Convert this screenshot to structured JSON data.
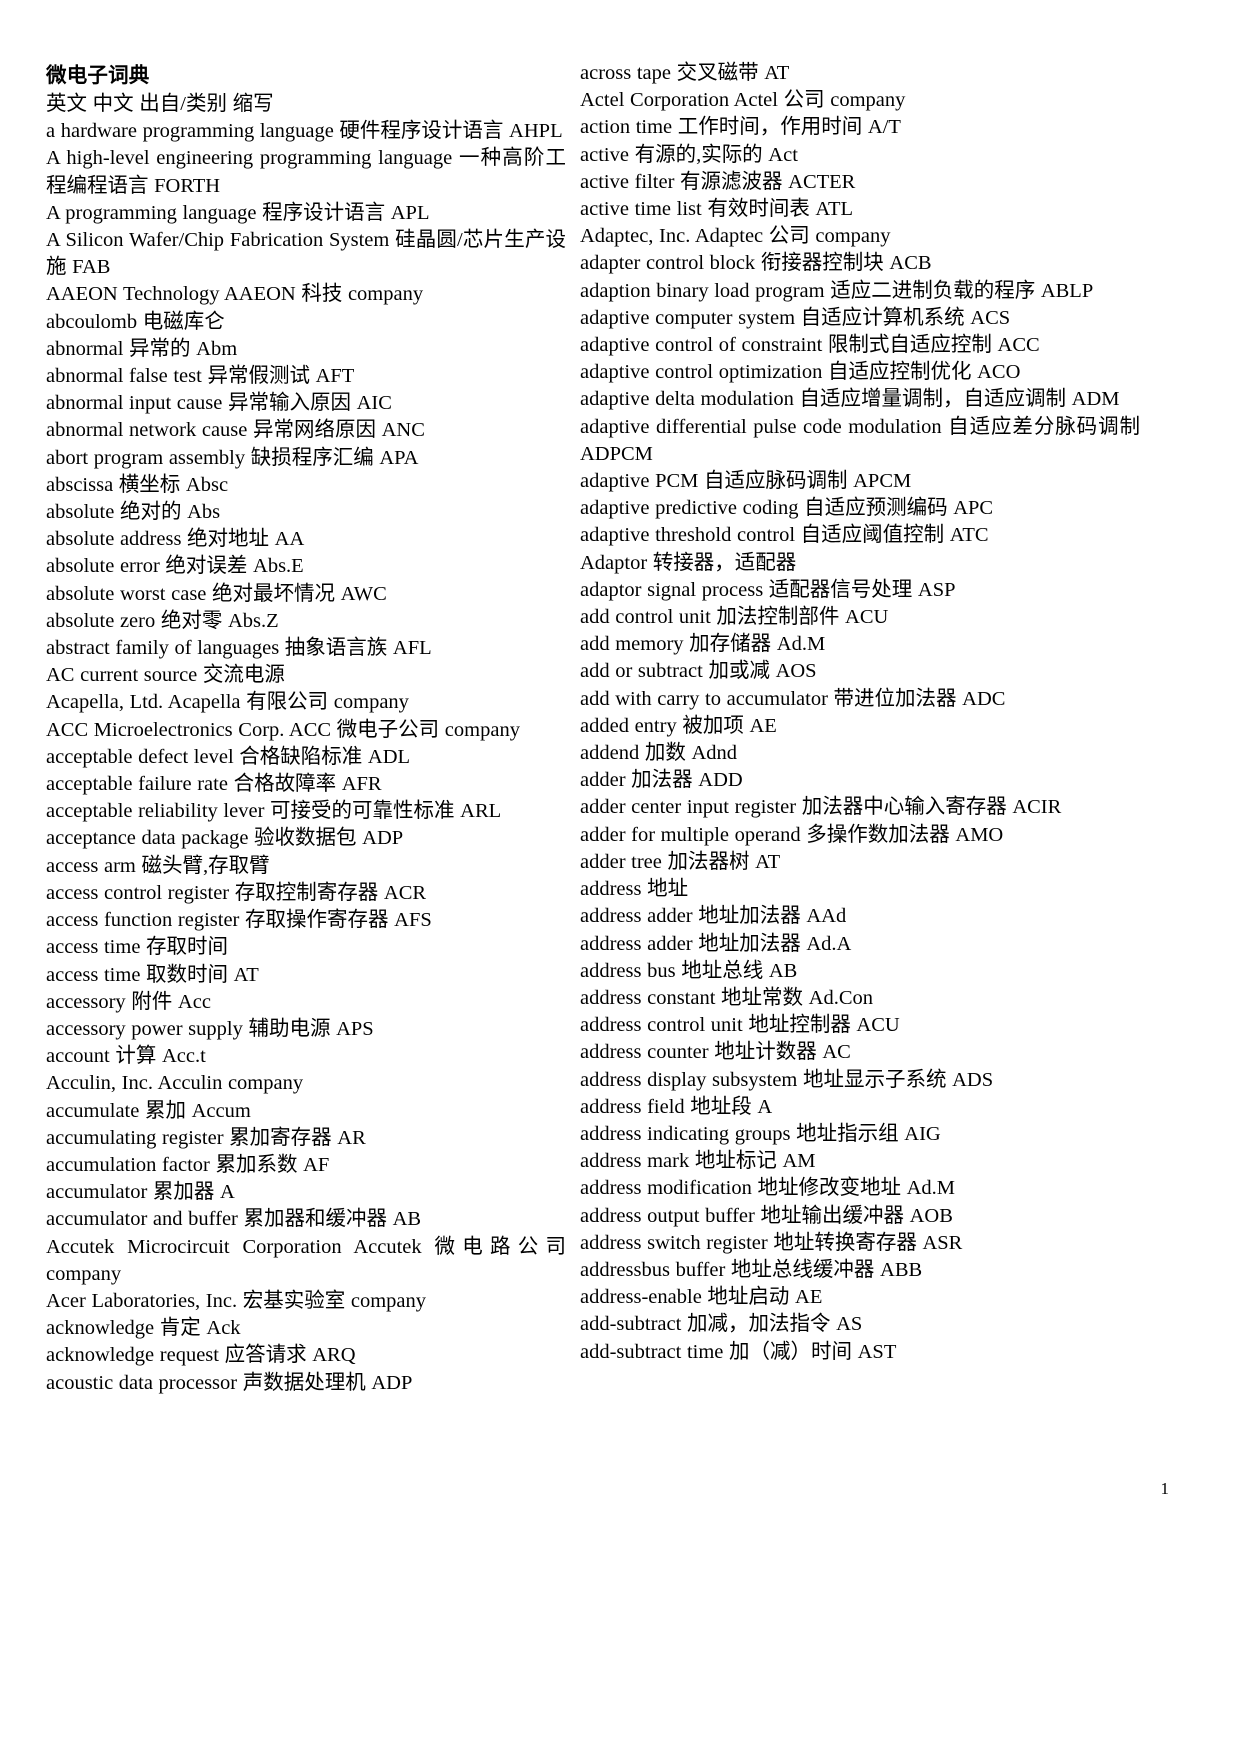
{
  "document": {
    "title": "微电子词典",
    "column_header": "英文 中文 出自/类别 缩写",
    "page_number": "1"
  },
  "left_column": {
    "entries": [
      "a hardware programming language 硬件程序设计语言 AHPL",
      "A high-level engineering programming language 一种高阶工程编程语言 FORTH",
      "A programming language 程序设计语言 APL",
      "A Silicon Wafer/Chip Fabrication System 硅晶圆/芯片生产设施 FAB",
      "AAEON Technology AAEON 科技 company",
      "abcoulomb 电磁库仑",
      "abnormal 异常的 Abm",
      "abnormal false test 异常假测试 AFT",
      "abnormal input cause 异常输入原因 AIC",
      "abnormal network cause 异常网络原因 ANC",
      "abort program assembly 缺损程序汇编 APA",
      "abscissa 横坐标 Absc",
      "absolute 绝对的 Abs",
      "absolute address 绝对地址 AA",
      "absolute error 绝对误差 Abs.E",
      "absolute worst case 绝对最坏情况 AWC",
      "absolute zero 绝对零 Abs.Z",
      "abstract family of languages 抽象语言族 AFL",
      "AC current source 交流电源",
      "Acapella, Ltd. Acapella 有限公司 company",
      "ACC Microelectronics Corp. ACC 微电子公司 company",
      "acceptable defect level 合格缺陷标准 ADL",
      "acceptable failure rate 合格故障率 AFR",
      "acceptable reliability lever 可接受的可靠性标准 ARL",
      "acceptance data package 验收数据包 ADP",
      "access arm 磁头臂,存取臂",
      "access control register 存取控制寄存器 ACR",
      "access function register 存取操作寄存器 AFS",
      "access time 存取时间",
      "access time 取数时间 AT",
      "accessory 附件 Acc",
      "accessory power supply 辅助电源 APS",
      "account 计算 Acc.t",
      "Acculin, Inc. Acculin company",
      "accumulate 累加 Accum",
      "accumulating register 累加寄存器 AR",
      "accumulation factor 累加系数 AF",
      "accumulator 累加器 A",
      "accumulator and buffer 累加器和缓冲器 AB",
      "Accutek Microcircuit Corporation Accutek 微电路公司 company",
      "Acer Laboratories, Inc. 宏基实验室 company",
      "acknowledge 肯定 Ack",
      "acknowledge request 应答请求 ARQ",
      "acoustic data processor 声数据处理机 ADP"
    ]
  },
  "right_column": {
    "entries": [
      "across tape 交叉磁带 AT",
      "Actel Corporation Actel 公司 company",
      "action time 工作时间，作用时间 A/T",
      "active 有源的,实际的 Act",
      "active filter 有源滤波器 ACTER",
      "active time list 有效时间表 ATL",
      "Adaptec, Inc. Adaptec 公司 company",
      "adapter control block 衔接器控制块 ACB",
      "adaption binary load program 适应二进制负载的程序 ABLP",
      "adaptive computer system 自适应计算机系统 ACS",
      "adaptive control of constraint 限制式自适应控制 ACC",
      "adaptive control optimization 自适应控制优化 ACO",
      "adaptive delta modulation 自适应增量调制，自适应调制 ADM",
      "adaptive differential pulse code modulation 自适应差分脉码调制 ADPCM",
      "adaptive PCM 自适应脉码调制 APCM",
      "adaptive predictive coding 自适应预测编码 APC",
      "adaptive threshold control 自适应阈值控制 ATC",
      "Adaptor 转接器，适配器",
      "adaptor signal process 适配器信号处理 ASP",
      "add control unit 加法控制部件 ACU",
      "add memory 加存储器 Ad.M",
      "add or subtract 加或减 AOS",
      "add with carry to accumulator 带进位加法器 ADC",
      "added entry 被加项 AE",
      "addend 加数 Adnd",
      "adder 加法器 ADD",
      "adder center input register 加法器中心输入寄存器 ACIR",
      "adder for multiple operand 多操作数加法器 AMO",
      "adder tree 加法器树 AT",
      "address 地址",
      "address adder 地址加法器 AAd",
      "address adder 地址加法器 Ad.A",
      "address bus 地址总线 AB",
      "address constant 地址常数 Ad.Con",
      "address control unit 地址控制器 ACU",
      "address counter 地址计数器 AC",
      "address display subsystem 地址显示子系统 ADS",
      "address field 地址段 A",
      "address indicating groups 地址指示组 AIG",
      "address mark 地址标记 AM",
      "address modification 地址修改变地址 Ad.M",
      "address output buffer 地址输出缓冲器 AOB",
      "address switch register 地址转换寄存器 ASR",
      "addressbus buffer 地址总线缓冲器 ABB",
      "address-enable 地址启动 AE",
      "add-subtract 加减，加法指令 AS",
      "add-subtract time 加（减）时间 AST"
    ]
  }
}
